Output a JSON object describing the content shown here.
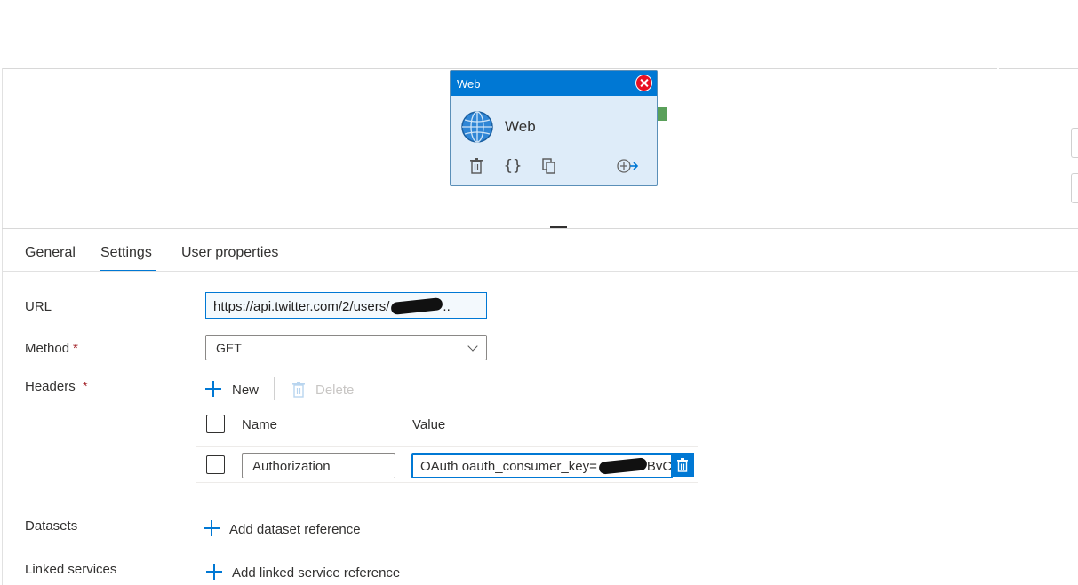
{
  "node": {
    "header_label": "Web",
    "name": "Web"
  },
  "tabs": [
    {
      "label": "General"
    },
    {
      "label": "Settings",
      "active": true
    },
    {
      "label": "User properties"
    }
  ],
  "form": {
    "url_label": "URL",
    "url_value": "https://api.twitter.com/2/users/",
    "url_suffix": "..",
    "method_label": "Method",
    "method_value": "GET",
    "required_marker": "*",
    "headers_label": "Headers",
    "new_label": "New",
    "delete_label": "Delete",
    "headers_table": {
      "columns": [
        "Name",
        "Value"
      ],
      "rows": [
        {
          "name": "Authorization",
          "value_prefix": "OAuth oauth_consumer_key=",
          "value_suffix": "BvCo"
        }
      ]
    },
    "datasets_label": "Datasets",
    "add_dataset_label": "Add dataset reference",
    "linked_services_label": "Linked services",
    "add_linked_service_label": "Add linked service reference"
  },
  "colors": {
    "accent": "#0078d4",
    "node_bg": "#deecf9",
    "error": "#e81123",
    "port": "#5aa05a"
  }
}
